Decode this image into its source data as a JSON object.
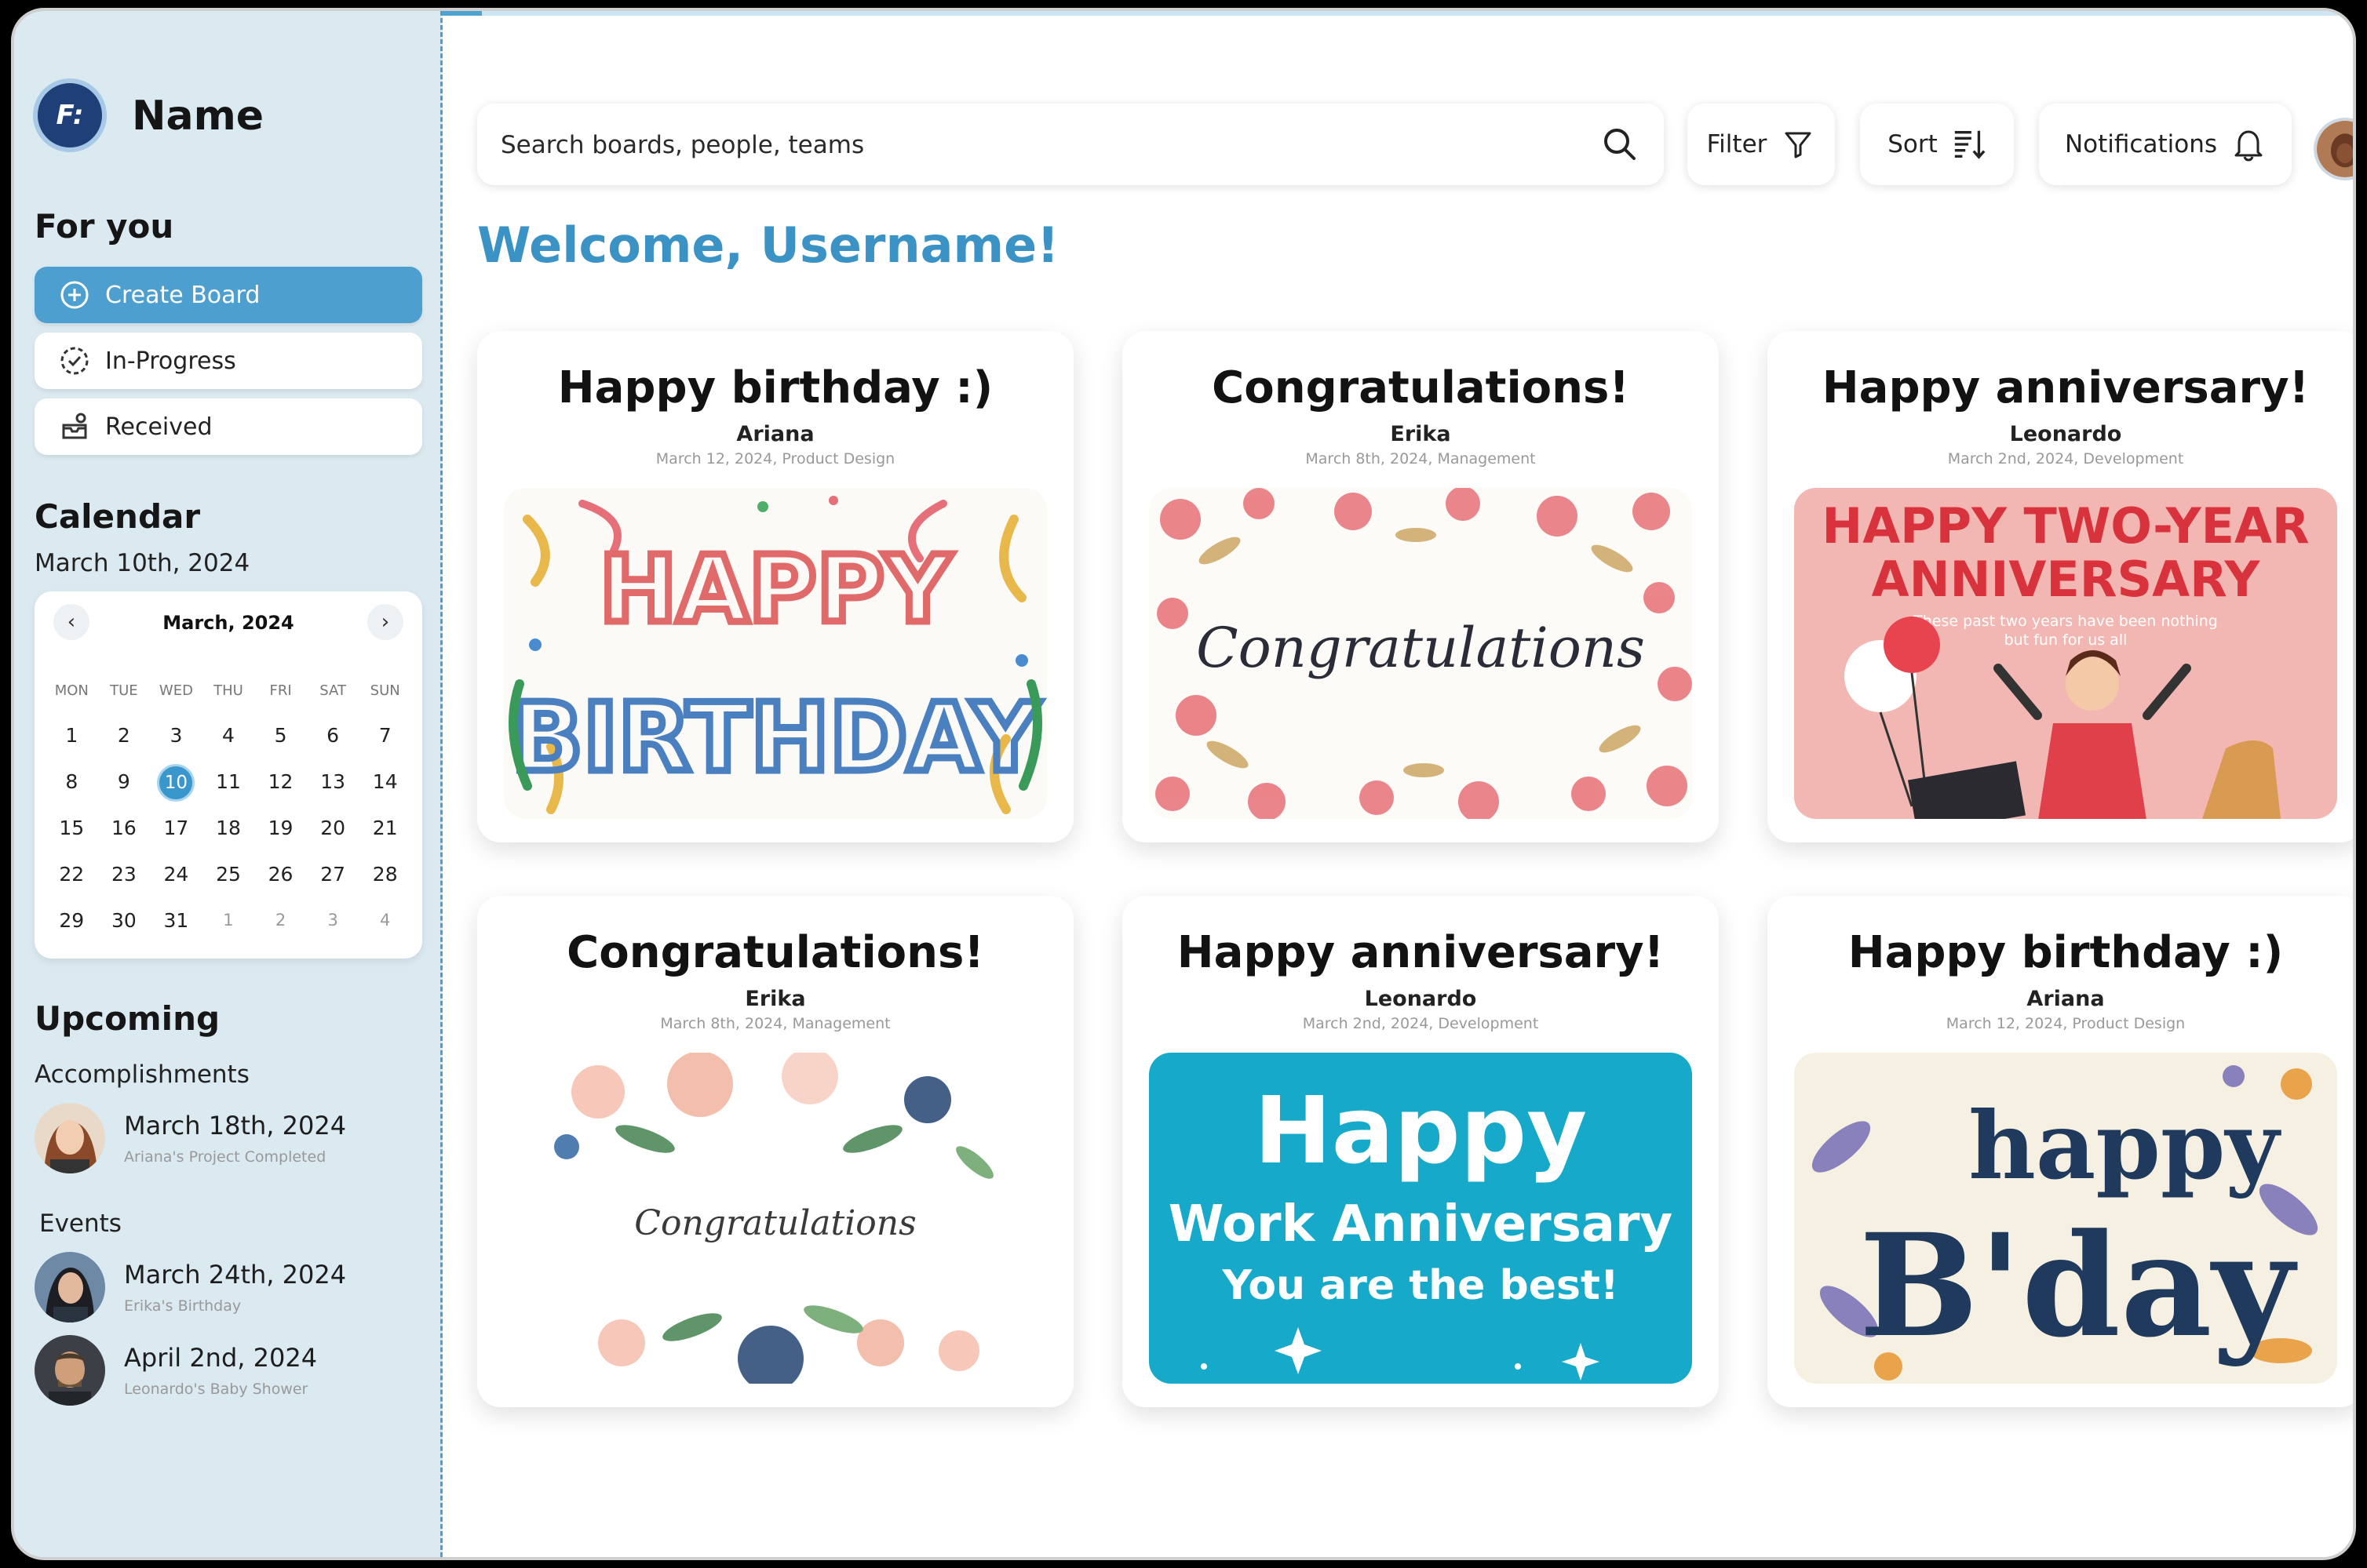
{
  "brand": {
    "name": "Name"
  },
  "sidebar": {
    "for_you_title": "For you",
    "buttons": [
      {
        "label": "Create Board",
        "icon": "plus-circle-icon"
      },
      {
        "label": "In-Progress",
        "icon": "progress-check-icon"
      },
      {
        "label": "Received",
        "icon": "inbox-received-icon"
      }
    ],
    "calendar_title": "Calendar",
    "calendar_date": "March 10th, 2024",
    "calendar": {
      "month": "March, 2024",
      "weekdays": [
        "MON",
        "TUE",
        "WED",
        "THU",
        "FRI",
        "SAT",
        "SUN"
      ],
      "days": [
        "1",
        "2",
        "3",
        "4",
        "5",
        "6",
        "7",
        "8",
        "9",
        "10",
        "11",
        "12",
        "13",
        "14",
        "15",
        "16",
        "17",
        "18",
        "19",
        "20",
        "21",
        "22",
        "23",
        "24",
        "25",
        "26",
        "27",
        "28",
        "29",
        "30",
        "31",
        "1",
        "2",
        "3",
        "4"
      ],
      "today": "10"
    },
    "upcoming_title": "Upcoming",
    "accomplishments_title": "Accomplishments",
    "accomplishments": [
      {
        "date": "March 18th, 2024",
        "desc": "Ariana's Project Completed"
      }
    ],
    "events_title": "Events",
    "events": [
      {
        "date": "March 24th, 2024",
        "desc": "Erika's Birthday"
      },
      {
        "date": "April 2nd, 2024",
        "desc": "Leonardo's Baby Shower"
      }
    ]
  },
  "toolbar": {
    "search_placeholder": "Search boards, people, teams",
    "filter_label": "Filter",
    "sort_label": "Sort",
    "notifications_label": "Notifications"
  },
  "welcome": "Welcome, Username!",
  "cards": [
    {
      "title": "Happy birthday :)",
      "name": "Ariana",
      "meta": "March 12, 2024, Product Design",
      "image_text": [
        "HAPPY",
        "BIRTHDAY"
      ]
    },
    {
      "title": "Congratulations!",
      "name": "Erika",
      "meta": "March 8th, 2024, Management",
      "image_text": [
        "Congratulations"
      ]
    },
    {
      "title": "Happy anniversary!",
      "name": "Leonardo",
      "meta": "March 2nd, 2024, Development",
      "image_text": [
        "HAPPY TWO-YEAR",
        "ANNIVERSARY",
        "These past two years have been nothing",
        "but fun for us all"
      ]
    },
    {
      "title": "Congratulations!",
      "name": "Erika",
      "meta": "March 8th, 2024, Management",
      "image_text": [
        "Congratulations"
      ]
    },
    {
      "title": "Happy anniversary!",
      "name": "Leonardo",
      "meta": "March 2nd, 2024, Development",
      "image_text": [
        "Happy",
        "Work Anniversary",
        "You are the best!"
      ]
    },
    {
      "title": "Happy birthday :)",
      "name": "Ariana",
      "meta": "March 12, 2024, Product Design",
      "image_text": [
        "happy",
        "B'day"
      ]
    }
  ],
  "colors": {
    "accent": "#3b92c4",
    "sidebar_bg": "#dbe9f1",
    "primary_button": "#4c9fce"
  }
}
